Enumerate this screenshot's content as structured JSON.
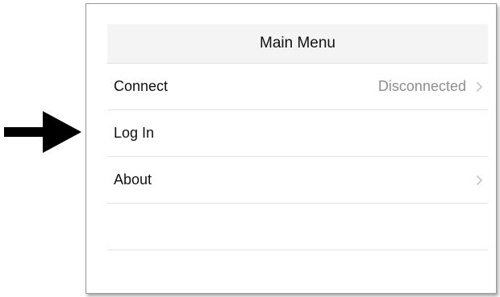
{
  "menu": {
    "title": "Main Menu",
    "items": [
      {
        "label": "Connect",
        "detail": "Disconnected",
        "has_chevron": true
      },
      {
        "label": "Log In",
        "detail": "",
        "has_chevron": false
      },
      {
        "label": "About",
        "detail": "",
        "has_chevron": true
      }
    ]
  },
  "icons": {
    "pointer_arrow": "right-arrow-icon",
    "disclosure": "chevron-right-icon"
  },
  "colors": {
    "header_bg": "#f4f4f4",
    "detail_text": "#8e8e93",
    "separator": "#e2e2e2",
    "arrow": "#000000"
  }
}
